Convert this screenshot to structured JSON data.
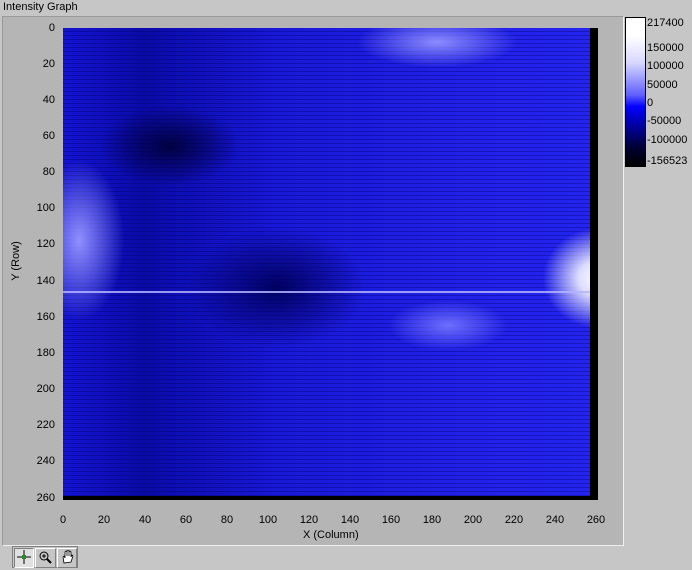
{
  "window": {
    "title": "Intensity Graph"
  },
  "graph": {
    "y_label": "Y (Row)",
    "x_label": "X (Column)",
    "y_ticks": [
      "0",
      "20",
      "40",
      "60",
      "80",
      "100",
      "120",
      "140",
      "160",
      "180",
      "200",
      "220",
      "240",
      "260"
    ],
    "x_ticks": [
      "0",
      "20",
      "40",
      "60",
      "80",
      "100",
      "120",
      "140",
      "160",
      "180",
      "200",
      "220",
      "240",
      "260"
    ]
  },
  "legend": {
    "ticks": [
      "217400",
      "150000",
      "100000",
      "50000",
      "0",
      "-50000",
      "-100000",
      "-156523"
    ]
  },
  "palette": {
    "tools": [
      "cursor-tool-icon",
      "zoom-tool-icon",
      "pan-hand-icon"
    ]
  }
}
